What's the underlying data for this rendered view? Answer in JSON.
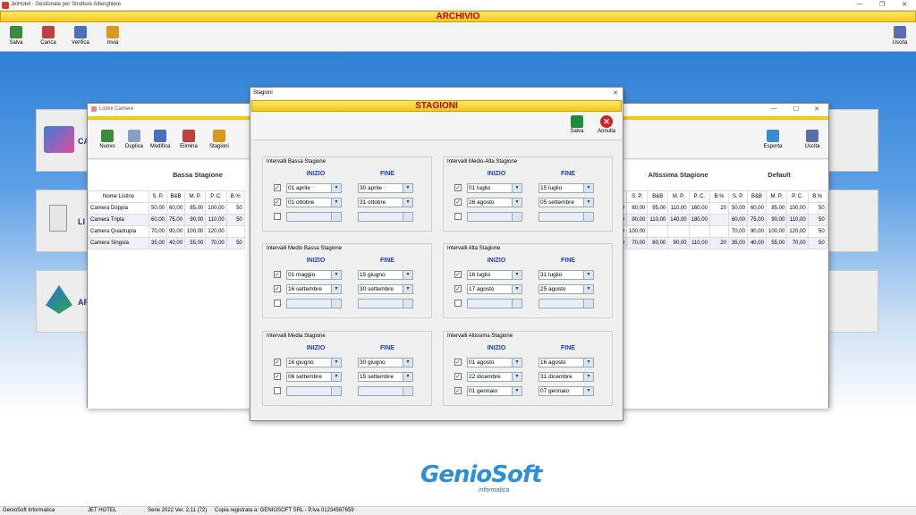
{
  "app": {
    "title": "JetHotel - Gestionale per Strutture Alberghiere",
    "header": "ARCHIVIO"
  },
  "toolbar": [
    {
      "label": "Salva",
      "icon": "save-icon",
      "color": "#3c8a3c"
    },
    {
      "label": "Carica",
      "icon": "load-icon",
      "color": "#c04040"
    },
    {
      "label": "Verifica",
      "icon": "verify-icon",
      "color": "#4a6fbd"
    },
    {
      "label": "Invia",
      "icon": "send-icon",
      "color": "#d99a1c"
    }
  ],
  "exit_label": "Uscita",
  "statusbar": {
    "company": "GenioSoft Informatica",
    "product": "JET HOTEL",
    "version": "Serie 2022 Ver. 2,11 (72)",
    "license": "Copia registrata a: GENIOSOFT SRL  - P.Iva 01234567659"
  },
  "logo": {
    "name": "GenioSoft",
    "sub": "informatica"
  },
  "listini": {
    "title": "Listini Camere",
    "toolbar": [
      "Nuovo",
      "Duplica",
      "Modifica",
      "Elimina",
      "Stagioni"
    ],
    "right_toolbar": [
      "Esporta",
      "Uscita"
    ],
    "groups_left": [
      "Bassa Stagione"
    ],
    "groups_right": [
      "Altissima Stagione",
      "Default"
    ],
    "headers_left": [
      "Nome Listino",
      "S. P.",
      "B&B",
      "M. P.",
      "P. C.",
      "B.%"
    ],
    "headers_right": [
      "S. P.",
      "B&B",
      "M. P.",
      "P. C.",
      "B.%",
      "S. P.",
      "B&B",
      "M. P.",
      "P. C.",
      "B.%"
    ],
    "rows": [
      {
        "name": "Camera Doppia",
        "left": [
          "50,00",
          "60,00",
          "85,00",
          "100,00",
          "50"
        ],
        "right": [
          "30",
          "80,00",
          "95,00",
          "110,00",
          "160,00",
          "20",
          "50,00",
          "60,00",
          "85,00",
          "100,00",
          "50"
        ]
      },
      {
        "name": "Camera Tripla",
        "left": [
          "60,00",
          "75,00",
          "90,00",
          "110,00",
          "50"
        ],
        "right": [
          "30",
          "90,00",
          "110,00",
          "140,00",
          "180,00",
          "",
          "60,00",
          "75,00",
          "90,00",
          "110,00",
          "50"
        ]
      },
      {
        "name": "Camera Quadrupla",
        "left": [
          "70,00",
          "90,00",
          "100,00",
          "120,00",
          ""
        ],
        "right": [
          "30",
          "100,00",
          "",
          "",
          "",
          "",
          "70,00",
          "90,00",
          "100,00",
          "120,00",
          "50"
        ]
      },
      {
        "name": "Camera Singola",
        "left": [
          "35,00",
          "40,00",
          "55,00",
          "70,00",
          "50"
        ],
        "right": [
          "30",
          "70,00",
          "80,00",
          "90,00",
          "110,00",
          "20",
          "35,00",
          "40,00",
          "55,00",
          "70,00",
          "50"
        ]
      }
    ]
  },
  "side_labels": [
    "CA",
    "LI",
    "AR"
  ],
  "stagioni": {
    "title": "Stagioni",
    "header": "STAGIONI",
    "save": "Salva",
    "cancel": "Annulla",
    "col_start": "INIZIO",
    "col_end": "FINE",
    "groups": [
      {
        "title": "Intervalli Bassa Stagione",
        "rows": [
          {
            "checked": true,
            "start": "01 aprile",
            "end": "30 aprile"
          },
          {
            "checked": true,
            "start": "01 ottobre",
            "end": "31 ottobre"
          },
          {
            "checked": false,
            "start": "",
            "end": ""
          }
        ]
      },
      {
        "title": "Intervalli Medio-Alta Stagione",
        "rows": [
          {
            "checked": true,
            "start": "01 luglio",
            "end": "15 luglio"
          },
          {
            "checked": true,
            "start": "26 agosto",
            "end": "05 settembre"
          },
          {
            "checked": false,
            "start": "",
            "end": ""
          }
        ]
      },
      {
        "title": "Intervalli Medio Bassa Stagione",
        "rows": [
          {
            "checked": true,
            "start": "01 maggio",
            "end": "15 giugno"
          },
          {
            "checked": true,
            "start": "16 settembre",
            "end": "30 settembre"
          },
          {
            "checked": false,
            "start": "",
            "end": ""
          }
        ]
      },
      {
        "title": "Intervalli Alta Stagione",
        "rows": [
          {
            "checked": true,
            "start": "16 luglio",
            "end": "31 luglio"
          },
          {
            "checked": true,
            "start": "17 agosto",
            "end": "25 agosto"
          },
          {
            "checked": false,
            "start": "",
            "end": ""
          }
        ]
      },
      {
        "title": "Intervalli Media Stagione",
        "rows": [
          {
            "checked": true,
            "start": "16 giugno",
            "end": "30 giugno"
          },
          {
            "checked": true,
            "start": "06 settembre",
            "end": "15 settembre"
          },
          {
            "checked": false,
            "start": "",
            "end": ""
          }
        ]
      },
      {
        "title": "Intervalli Altissima Stagione",
        "rows": [
          {
            "checked": true,
            "start": "01 agosto",
            "end": "16 agosto"
          },
          {
            "checked": true,
            "start": "22 dicembre",
            "end": "31 dicembre"
          },
          {
            "checked": true,
            "start": "01 gennaio",
            "end": "07 gennaio"
          }
        ]
      }
    ]
  }
}
